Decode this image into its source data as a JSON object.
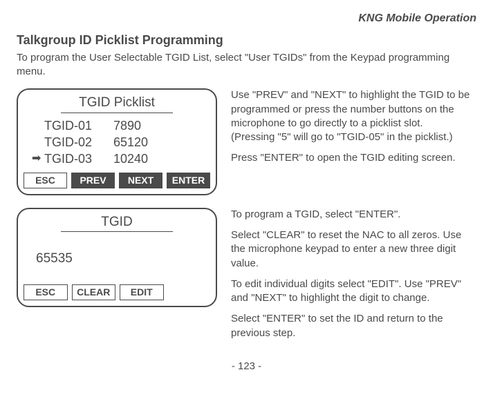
{
  "header": "KNG Mobile Operation",
  "title": "Talkgroup ID Picklist Programming",
  "intro": "To program the User Selectable TGID List, select \"User TGIDs\" from the Keypad programming menu.",
  "screen1": {
    "title": "TGID Picklist",
    "rows": [
      {
        "arrow": "",
        "label": "TGID-01",
        "value": "7890"
      },
      {
        "arrow": "",
        "label": "TGID-02",
        "value": "65120"
      },
      {
        "arrow": "➡",
        "label": "TGID-03",
        "value": "10240"
      }
    ],
    "buttons": {
      "esc": "ESC",
      "prev": "PREV",
      "next": "NEXT",
      "enter": "ENTER"
    }
  },
  "text1": {
    "p1": "Use \"PREV\" and \"NEXT\" to highlight the TGID to be programmed or press the number buttons on the microphone to go directly to a picklist slot.",
    "p2": "(Pressing \"5\" will go to \"TGID-05\" in the picklist.)",
    "p3": "Press \"ENTER\" to open the TGID editing screen."
  },
  "screen2": {
    "title": "TGID",
    "value": "65535",
    "buttons": {
      "esc": "ESC",
      "clear": "CLEAR",
      "edit": "EDIT"
    }
  },
  "text2": {
    "p1": "To program a TGID, select \"ENTER\".",
    "p2": "Select \"CLEAR\" to reset the NAC to all zeros. Use the microphone keypad to enter a new three digit value.",
    "p3": "To edit individual digits select \"EDIT\". Use \"PREV\" and \"NEXT\" to highlight the digit to change.",
    "p4": "Select \"ENTER\" to set the ID and return to the previous step."
  },
  "page": "- 123 -"
}
